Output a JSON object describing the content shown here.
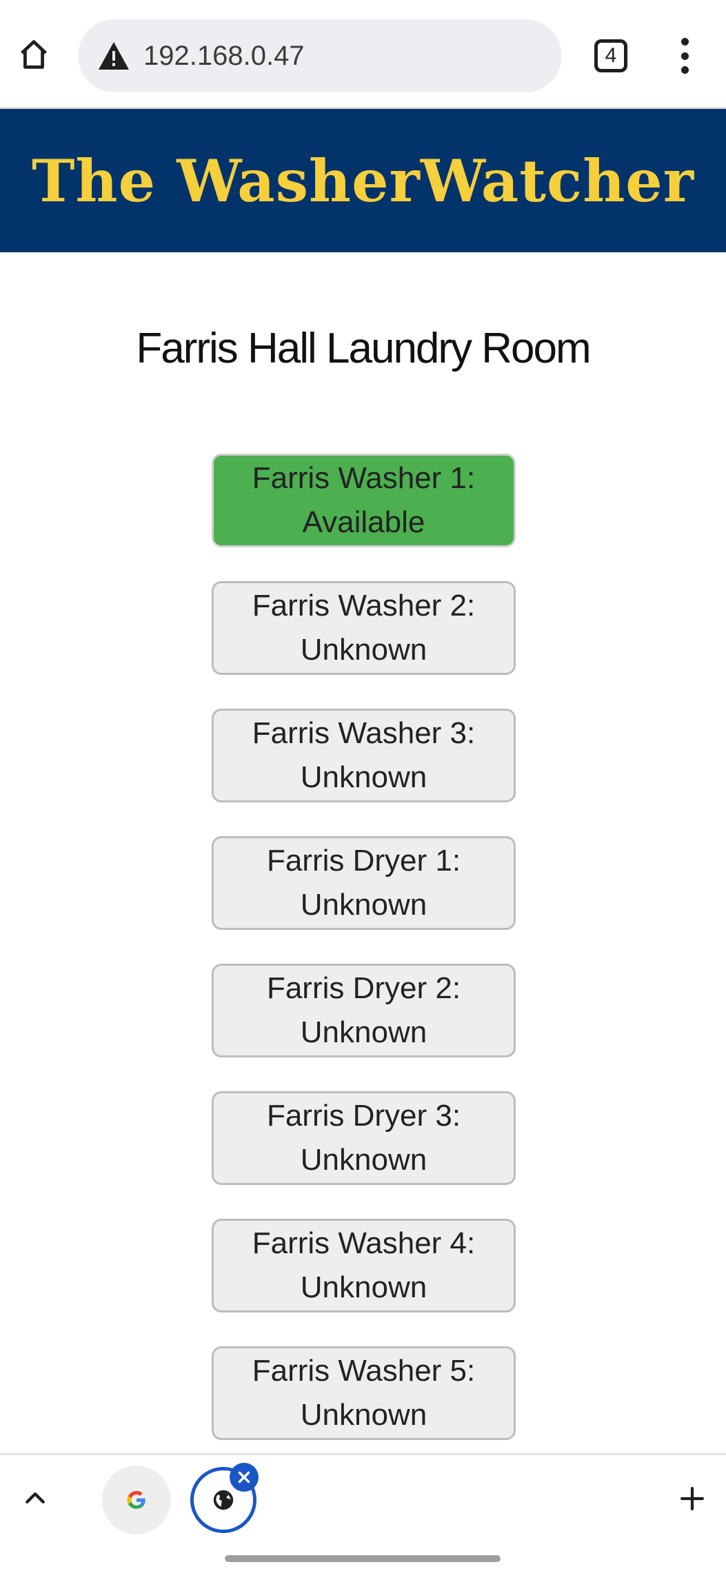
{
  "browser": {
    "url": "192.168.0.47",
    "tab_count": "4",
    "icons": [
      "home-icon",
      "warning-icon",
      "more-vert-icon",
      "chevron-up-icon",
      "google-icon",
      "globe-icon",
      "close-icon",
      "plus-icon"
    ]
  },
  "banner": {
    "title": "The WasherWatcher",
    "bg_color": "#02336a",
    "title_color": "#f5cf3c"
  },
  "page": {
    "heading": "Farris Hall Laundry Room"
  },
  "machines": [
    {
      "name": "Farris Washer 1:",
      "status": "Available",
      "color": "#4caf50"
    },
    {
      "name": "Farris Washer 2:",
      "status": "Unknown",
      "color": "#eeeeee"
    },
    {
      "name": "Farris Washer 3:",
      "status": "Unknown",
      "color": "#eeeeee"
    },
    {
      "name": "Farris Dryer 1:",
      "status": "Unknown",
      "color": "#eeeeee"
    },
    {
      "name": "Farris Dryer 2:",
      "status": "Unknown",
      "color": "#eeeeee"
    },
    {
      "name": "Farris Dryer 3:",
      "status": "Unknown",
      "color": "#eeeeee"
    },
    {
      "name": "Farris Washer 4:",
      "status": "Unknown",
      "color": "#eeeeee"
    },
    {
      "name": "Farris Washer 5:",
      "status": "Unknown",
      "color": "#eeeeee"
    }
  ]
}
